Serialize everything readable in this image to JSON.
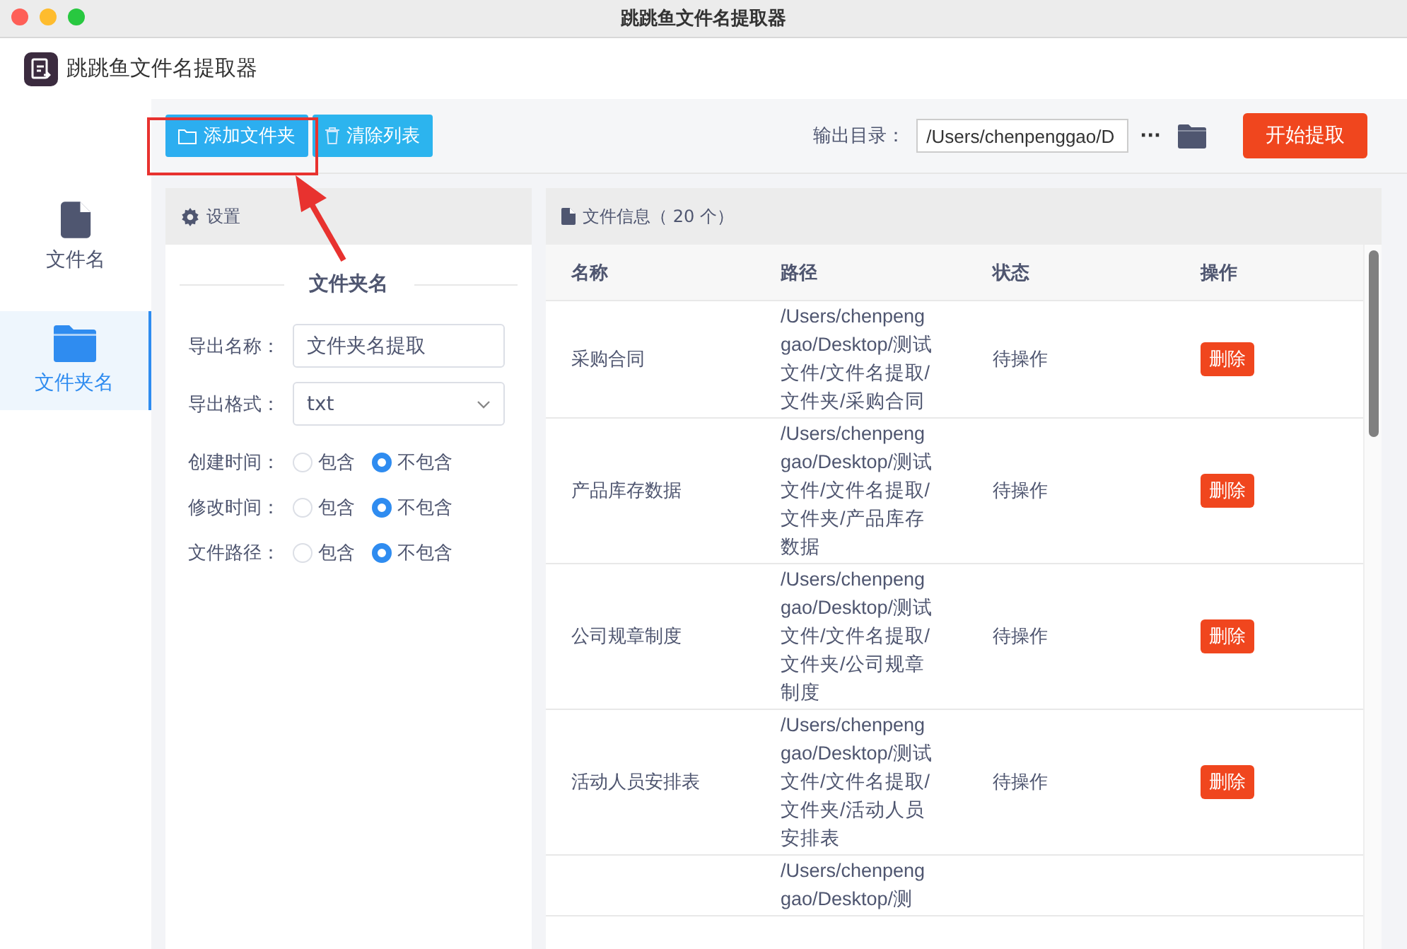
{
  "window": {
    "title": "跳跳鱼文件名提取器"
  },
  "app": {
    "name": "跳跳鱼文件名提取器"
  },
  "sidebar": {
    "items": [
      {
        "label": "文件名",
        "kind": "file",
        "selected": false
      },
      {
        "label": "文件夹名",
        "kind": "folder",
        "selected": true
      }
    ]
  },
  "toolbar": {
    "add_button": "添加文件夹",
    "clear_button": "清除列表",
    "output_label": "输出目录：",
    "output_path": "/Users/chenpenggao/D",
    "more_button": "···",
    "start_button": "开始提取"
  },
  "settings": {
    "title": "设置",
    "section": "文件夹名",
    "export_name_label": "导出名称：",
    "export_name": "文件夹名提取",
    "format_label": "导出格式：",
    "format": "txt",
    "options": [
      {
        "label": "创建时间：",
        "choices": [
          {
            "label": "包含",
            "selected": false
          },
          {
            "label": "不包含",
            "selected": true
          }
        ]
      },
      {
        "label": "修改时间：",
        "choices": [
          {
            "label": "包含",
            "selected": false
          },
          {
            "label": "不包含",
            "selected": true
          }
        ]
      },
      {
        "label": "文件路径：",
        "choices": [
          {
            "label": "包含",
            "selected": false
          },
          {
            "label": "不包含",
            "selected": true
          }
        ]
      }
    ]
  },
  "file_panel": {
    "title": "文件信息（ 20 个）",
    "columns": [
      "名称",
      "路径",
      "状态",
      "操作"
    ],
    "rows": [
      {
        "name": "采购合同",
        "path": "/Users/chenpenggao/Desktop/测试文件/文件名提取/文件夹/采购合同",
        "status": "待操作",
        "action": "删除"
      },
      {
        "name": "产品库存数据",
        "path": "/Users/chenpenggao/Desktop/测试文件/文件名提取/文件夹/产品库存数据",
        "status": "待操作",
        "action": "删除"
      },
      {
        "name": "公司规章制度",
        "path": "/Users/chenpenggao/Desktop/测试文件/文件名提取/文件夹/公司规章制度",
        "status": "待操作",
        "action": "删除"
      },
      {
        "name": "活动人员安排表",
        "path": "/Users/chenpenggao/Desktop/测试文件/文件名提取/文件夹/活动人员安排表",
        "status": "待操作",
        "action": "删除"
      },
      {
        "path": "/Users/chenpenggao/Desktop/测"
      }
    ]
  }
}
